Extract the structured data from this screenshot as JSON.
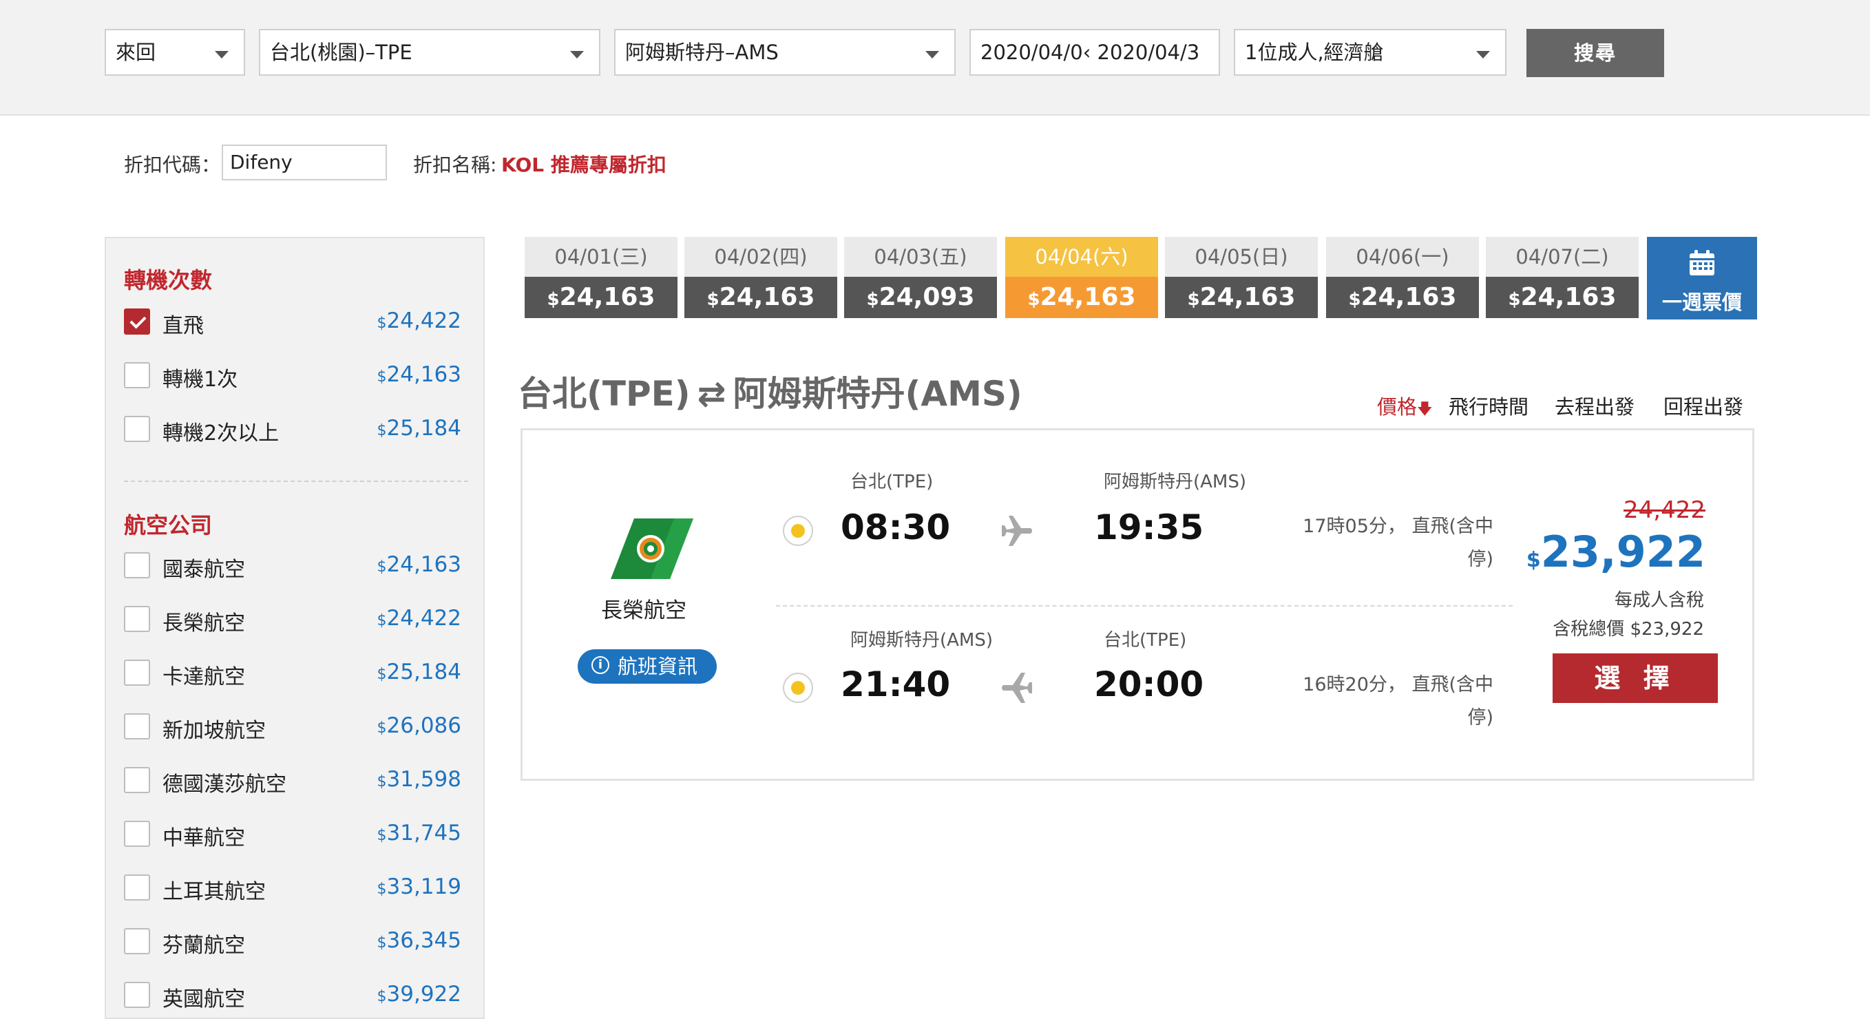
{
  "search": {
    "trip_type": "來回",
    "origin": "台北(桃園)–TPE",
    "destination": "阿姆斯特丹–AMS",
    "dates": "2020/04/0‹ 2020/04/3",
    "passengers": "1位成人,經濟艙",
    "search_button": "搜尋"
  },
  "discount": {
    "code_label": "折扣代碼：",
    "code_value": "Difeny",
    "name_label": "折扣名稱:",
    "name_value": "KOL 推薦專屬折扣"
  },
  "sidebar": {
    "stops_heading": "轉機次數",
    "stops": [
      {
        "label": "直飛",
        "price": "24,422",
        "checked": true
      },
      {
        "label": "轉機1次",
        "price": "24,163",
        "checked": false
      },
      {
        "label": "轉機2次以上",
        "price": "25,184",
        "checked": false
      }
    ],
    "airlines_heading": "航空公司",
    "airlines": [
      {
        "label": "國泰航空",
        "price": "24,163"
      },
      {
        "label": "長榮航空",
        "price": "24,422"
      },
      {
        "label": "卡達航空",
        "price": "25,184"
      },
      {
        "label": "新加坡航空",
        "price": "26,086"
      },
      {
        "label": "德國漢莎航空",
        "price": "31,598"
      },
      {
        "label": "中華航空",
        "price": "31,745"
      },
      {
        "label": "土耳其航空",
        "price": "33,119"
      },
      {
        "label": "芬蘭航空",
        "price": "36,345"
      },
      {
        "label": "英國航空",
        "price": "39,922"
      }
    ],
    "currency_symbol": "$"
  },
  "dates": [
    {
      "date": "04/01(三)",
      "price": "24,163"
    },
    {
      "date": "04/02(四)",
      "price": "24,163"
    },
    {
      "date": "04/03(五)",
      "price": "24,093"
    },
    {
      "date": "04/04(六)",
      "price": "24,163",
      "active": true
    },
    {
      "date": "04/05(日)",
      "price": "24,163"
    },
    {
      "date": "04/06(一)",
      "price": "24,163"
    },
    {
      "date": "04/07(二)",
      "price": "24,163"
    }
  ],
  "week_price_label": "一週票價",
  "route": {
    "from": "台北(TPE)",
    "swap_icon": "⇄",
    "to": "阿姆斯特丹(AMS)"
  },
  "sort": {
    "price": "價格",
    "price_arrow": "🡇",
    "duration": "飛行時間",
    "outbound": "去程出發",
    "return": "回程出發"
  },
  "flight": {
    "airline": "長榮航空",
    "info_button": "航班資訊",
    "outbound": {
      "from_city": "台北(TPE)",
      "to_city": "阿姆斯特丹(AMS)",
      "depart": "08:30",
      "arrive": "19:35",
      "duration_line1": "17時05分， 直飛(含中",
      "duration_line2": "停)"
    },
    "return": {
      "from_city": "阿姆斯特丹(AMS)",
      "to_city": "台北(TPE)",
      "depart": "21:40",
      "arrive": "20:00",
      "duration_line1": "16時20分， 直飛(含中",
      "duration_line2": "停)"
    },
    "old_price": "24,422",
    "currency_symbol": "$",
    "new_price": "23,922",
    "per_adult": "每成人含稅",
    "total": "含稅總價 $23,922",
    "select_button": "選 擇"
  },
  "colors": {
    "brand_red": "#b52a2e",
    "blue": "#1e73be",
    "active_tab": "#f59a33",
    "dark_tab": "#555555"
  }
}
